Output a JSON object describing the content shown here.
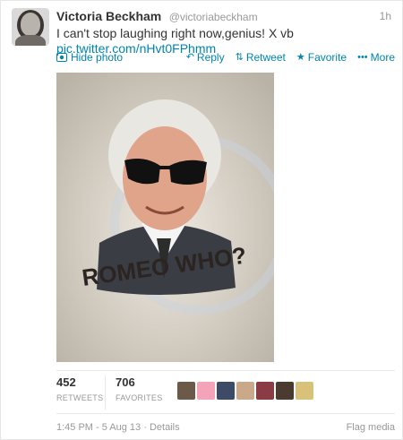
{
  "tweet": {
    "fullname": "Victoria Beckham",
    "username": "@victoriabeckham",
    "time": "1h",
    "text": "I can't stop laughing right now,genius! X vb",
    "link": "pic.twitter.com/nHvt0FPhmm",
    "photo_caption": "ROMEO WHO?"
  },
  "actions": {
    "hide_photo": "Hide photo",
    "reply": "Reply",
    "retweet": "Retweet",
    "favorite": "Favorite",
    "more": "More"
  },
  "stats": {
    "retweets_count": "452",
    "retweets_label": "RETWEETS",
    "favorites_count": "706",
    "favorites_label": "FAVORITES"
  },
  "favoriters": [
    {
      "name": "favoriter-1",
      "color": "#6b5a4a"
    },
    {
      "name": "favoriter-2",
      "color": "#f5a3b8"
    },
    {
      "name": "favoriter-3",
      "color": "#3c4b66"
    },
    {
      "name": "favoriter-4",
      "color": "#c9a98a"
    },
    {
      "name": "favoriter-5",
      "color": "#8a3b44"
    },
    {
      "name": "favoriter-6",
      "color": "#4a3a30"
    },
    {
      "name": "favoriter-7",
      "color": "#d8c27a"
    }
  ],
  "footer": {
    "date": "1:45 PM - 5 Aug 13 · Details",
    "flag": "Flag media"
  },
  "colors": {
    "link": "#0084b4",
    "muted": "#999999",
    "text": "#333333"
  }
}
